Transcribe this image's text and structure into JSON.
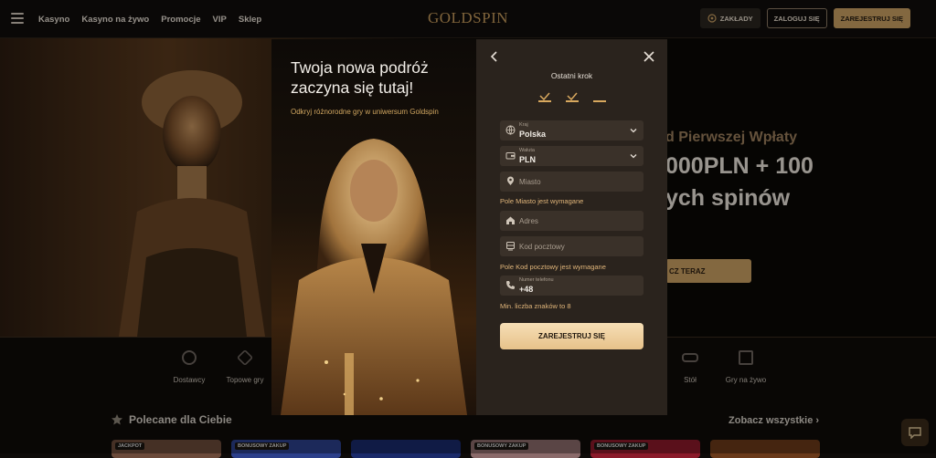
{
  "nav": {
    "links": [
      "Kasyno",
      "Kasyno na żywo",
      "Promocje",
      "VIP",
      "Sklep"
    ],
    "logo": "GOLDSPIN",
    "bets_label": "ZAKŁADY",
    "login_label": "ZALOGUJ SIĘ",
    "register_label": "ZAREJESTRUJ SIĘ"
  },
  "hero": {
    "line1": "d Pierwszej Wpłaty",
    "line2": "000PLN + 100",
    "line3": "ych spinów",
    "cta": "CZ TERAZ"
  },
  "categories": [
    {
      "label": "Dostawcy",
      "icon": "globe-icon"
    },
    {
      "label": "Topowe gry",
      "icon": "diamond-icon"
    },
    {
      "label": "Stół",
      "icon": "table-icon"
    },
    {
      "label": "Gry na żywo",
      "icon": "gift-icon"
    }
  ],
  "recommended": {
    "title": "Polecane dla Ciebie",
    "see_all": "Zobacz wszystkie",
    "thumbs": [
      {
        "tag": "JACKPOT"
      },
      {
        "tag": "BONUSOWY ZAKUP"
      },
      {
        "tag": ""
      },
      {
        "tag": "BONUSOWY ZAKUP"
      },
      {
        "tag": "BONUSOWY ZAKUP"
      },
      {
        "tag": ""
      }
    ]
  },
  "modal": {
    "left_title": "Twoja nowa podróż zaczyna się tutaj!",
    "left_subtitle": "Odkryj różnorodne gry w uniwersum Goldspin",
    "step_title": "Ostatni krok",
    "fields": {
      "country": {
        "label": "Kraj",
        "value": "Polska"
      },
      "currency": {
        "label": "Waluta",
        "value": "PLN"
      },
      "city": {
        "placeholder": "Miasto"
      },
      "address": {
        "placeholder": "Adres"
      },
      "postcode": {
        "placeholder": "Kod pocztowy"
      },
      "phone": {
        "label": "Numer telefonu",
        "value": "+48"
      }
    },
    "errors": {
      "city": "Pole Miasto jest wymagane",
      "postcode": "Pole Kod pocztowy jest wymagane",
      "phone": "Min. liczba znaków to 8"
    },
    "submit_label": "ZAREJESTRUJ SIĘ"
  },
  "colors": {
    "accent_gold": "#c9a063",
    "panel": "#2a231d",
    "field": "#3a3129",
    "error_text": "#e0b57a"
  }
}
